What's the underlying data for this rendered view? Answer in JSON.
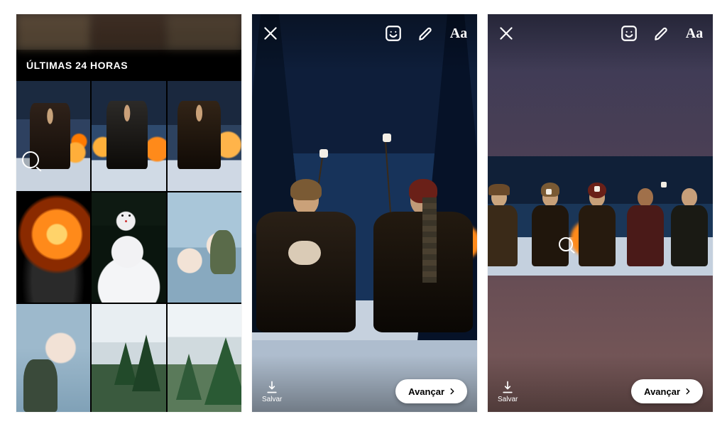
{
  "screen1": {
    "section_title": "ÚLTIMAS 24 HORAS",
    "selection_indicator_icon": "magnify-icon"
  },
  "editor": {
    "close_icon": "close-icon",
    "sticker_icon": "sticker-icon",
    "draw_icon": "draw-icon",
    "text_tool": "Aa",
    "save_icon": "download-icon",
    "save_label": "Salvar",
    "next_label": "Avançar",
    "next_icon": "chevron-right-icon"
  }
}
